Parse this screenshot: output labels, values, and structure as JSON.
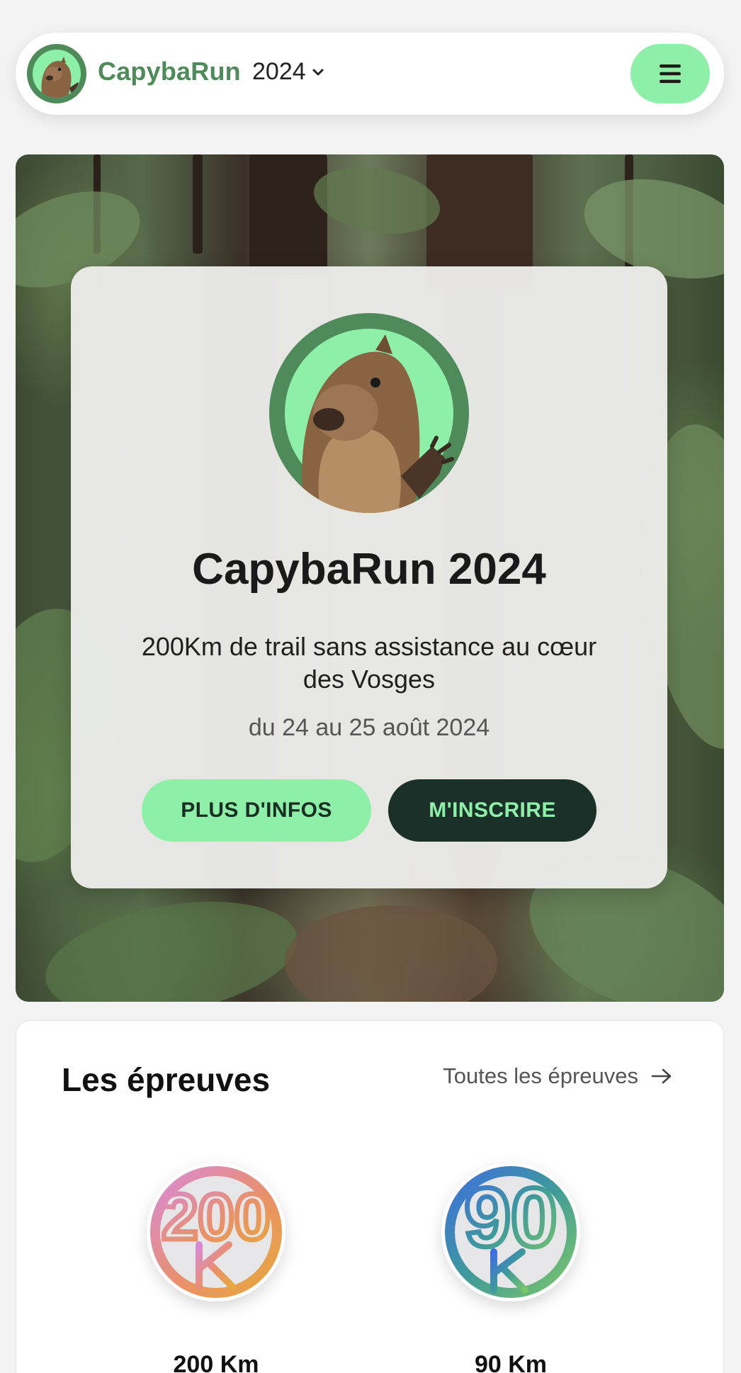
{
  "nav": {
    "brand": "CapybaRun",
    "year": "2024"
  },
  "hero": {
    "title": "CapybaRun 2024",
    "description": "200Km de trail sans assistance au cœur des Vosges",
    "date": "du 24 au 25 août 2024",
    "info_button": "PLUS D'INFOS",
    "register_button": "M'INSCRIRE"
  },
  "events": {
    "title": "Les épreuves",
    "link_label": "Toutes les épreuves",
    "items": [
      {
        "label": "200 Km",
        "badge_text": "200"
      },
      {
        "label": "90 Km",
        "badge_text": "90"
      }
    ]
  },
  "colors": {
    "accent": "#8ef0a8",
    "brand_green": "#4e8a5a",
    "dark_button": "#1b3028"
  }
}
